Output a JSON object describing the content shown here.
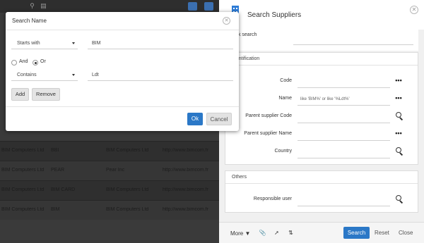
{
  "colors": {
    "accent": "#2b78c7",
    "overlay": "#2b2b2b"
  },
  "background_table": {
    "rows": [
      [
        "BIM Computers Ltd",
        "BBI",
        "BIM Computers Ltd",
        "http://www.bimcom.fr"
      ],
      [
        "BIM Computers Ltd",
        "PEAR",
        "Pear Inc",
        "http://www.bimcom.fr"
      ],
      [
        "BIM Computers Ltd",
        "BIM CARD",
        "BIM Computers Ltd",
        "http://www.bimcom.fr"
      ],
      [
        "BIM Computers Ltd",
        "BIM",
        "BIM Computers Ltd",
        "http://www.bimcom.fr"
      ]
    ]
  },
  "panel": {
    "title": "Search Suppliers",
    "quick_search_label": "uick search",
    "sections": {
      "identification": {
        "title": "Identification",
        "fields": [
          {
            "label": "Code",
            "value": ""
          },
          {
            "label": "Name",
            "value": "like 'BIM%' or like '%Ldt%'"
          },
          {
            "label": "Parent supplier Code",
            "value": ""
          },
          {
            "label": "Parent supplier Name",
            "value": ""
          },
          {
            "label": "Country",
            "value": ""
          }
        ]
      },
      "others": {
        "title": "Others",
        "fields": [
          {
            "label": "Responsible user",
            "value": ""
          }
        ]
      }
    },
    "footer": {
      "more_label": "More",
      "search_label": "Search",
      "reset_label": "Reset",
      "close_label": "Close"
    }
  },
  "dialog": {
    "title": "Search Name",
    "row1": {
      "operator": "Starts with",
      "value": "BIM"
    },
    "logic": {
      "and_label": "And",
      "or_label": "Or",
      "selected": "Or"
    },
    "row2": {
      "operator": "Contains",
      "value": "Ldt"
    },
    "add_label": "Add",
    "remove_label": "Remove",
    "ok_label": "Ok",
    "cancel_label": "Cancel"
  }
}
